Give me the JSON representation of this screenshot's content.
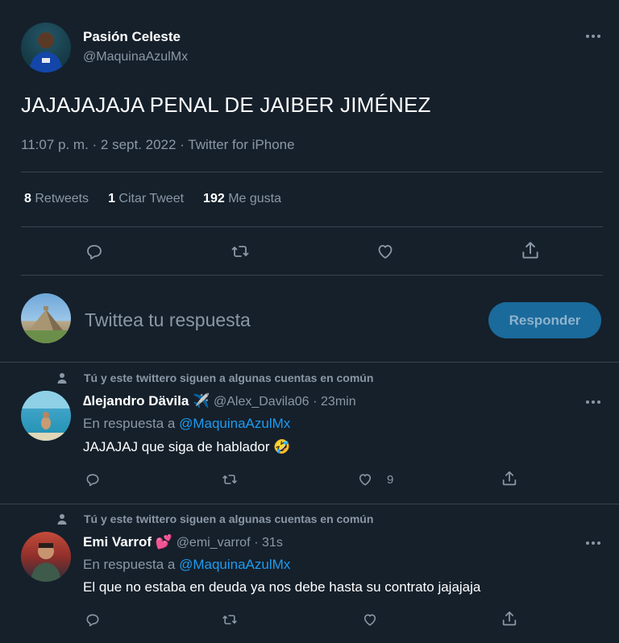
{
  "main_tweet": {
    "display_name": "Pasión Celeste",
    "handle": "@MaquinaAzulMx",
    "text": "JAJAJAJAJA PENAL DE JAIBER JIMÉNEZ",
    "meta": "11:07 p. m. · 2 sept. 2022 · Twitter for iPhone",
    "stats": {
      "retweets_count": "8",
      "retweets_label": "Retweets",
      "quotes_count": "1",
      "quotes_label": "Citar Tweet",
      "likes_count": "192",
      "likes_label": "Me gusta"
    },
    "actions": [
      "reply-icon",
      "retweet-icon",
      "like-icon",
      "share-icon"
    ]
  },
  "composer": {
    "placeholder": "Twittea tu respuesta",
    "button_label": "Responder"
  },
  "replies": [
    {
      "context": "Tú y este twittero siguen a algunas cuentas en común",
      "display_name": "∆lejandro Dävila",
      "badge_emoji": "✈️",
      "handle": "@Alex_Davila06",
      "time": "· 23min",
      "reply_prefix": "En respuesta a",
      "reply_to": "@MaquinaAzulMx",
      "text": "JAJAJAJ que siga de hablador 🤣",
      "like_count": "9"
    },
    {
      "context": "Tú y este twittero siguen a algunas cuentas en común",
      "display_name": "Emi Varrof",
      "badge_emoji": "💕",
      "handle": "@emi_varrof",
      "time": "· 31s",
      "reply_prefix": "En respuesta a",
      "reply_to": "@MaquinaAzulMx",
      "text": "El que no estaba en deuda ya nos debe hasta su contrato jajajaja",
      "like_count": ""
    }
  ],
  "colors": {
    "background": "#15202b",
    "accent": "#1d9bf0",
    "muted": "#8b98a5",
    "divider": "#38444d",
    "button_bg": "#1a6a9c"
  }
}
